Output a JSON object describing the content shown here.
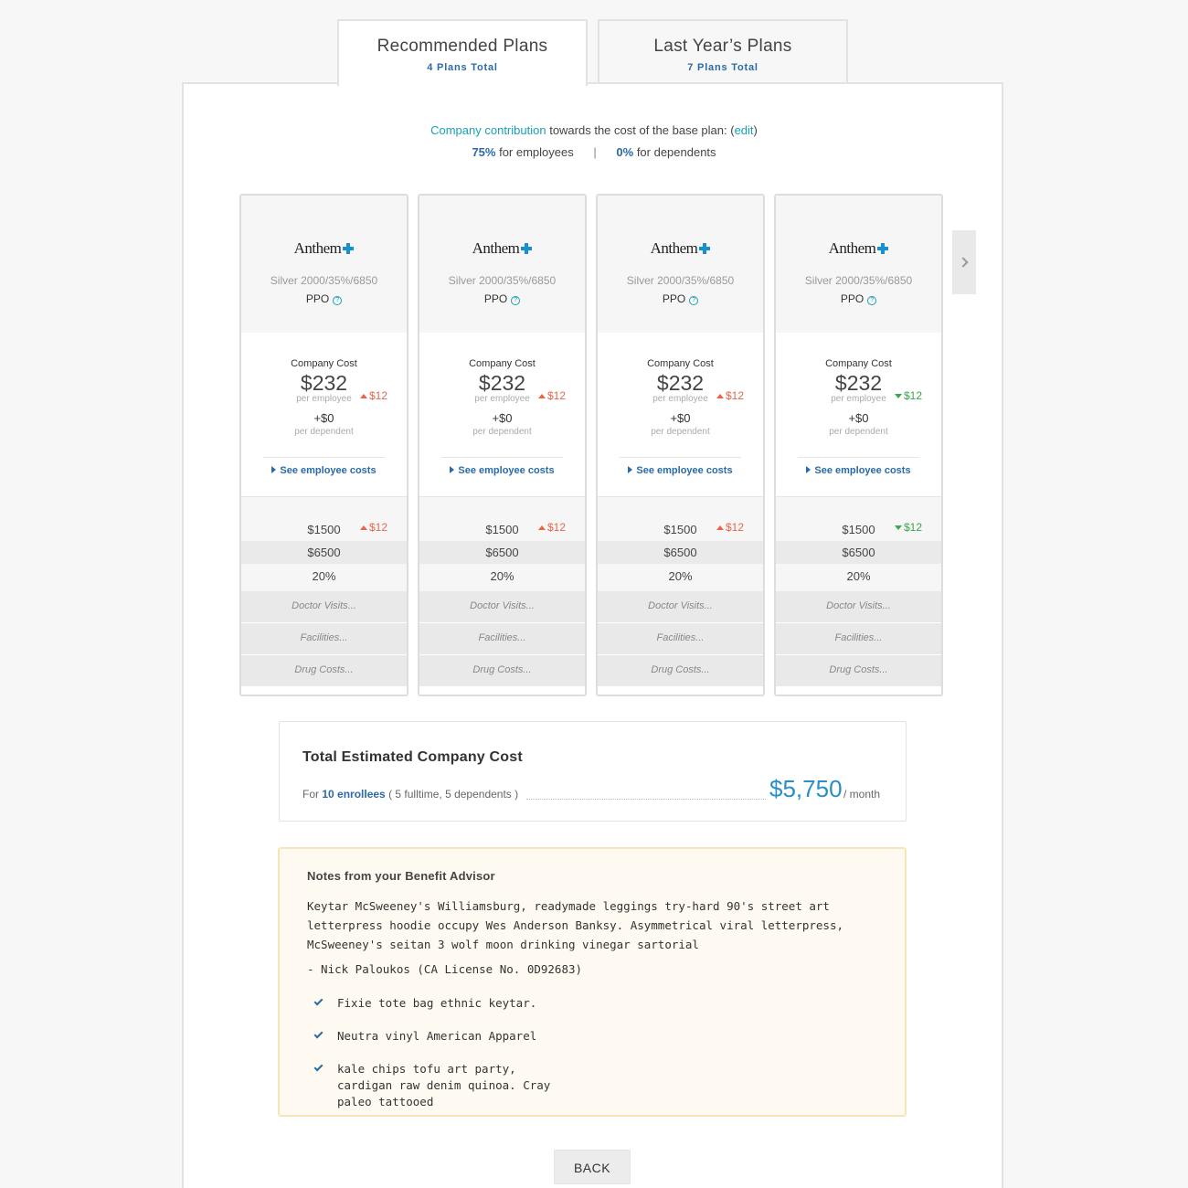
{
  "tabs": [
    {
      "title": "Recommended Plans",
      "subtitle": "4 Plans Total"
    },
    {
      "title": "Last Year’s Plans",
      "subtitle": "7 Plans Total"
    }
  ],
  "contribution": {
    "link_text": "Company contribution",
    "text": "towards the cost of the base plan:",
    "edit_open": "(",
    "edit_label": "edit",
    "edit_close": ")",
    "employee_pct": "75%",
    "employee_text": "for employees",
    "divider": "|",
    "dependent_pct": "0%",
    "dependent_text": "for dependents"
  },
  "cards": [
    {
      "carrier": "Anthem",
      "plan_name": "Silver 2000/35%/6850",
      "plan_type": "PPO",
      "cost_label": "Company Cost",
      "cost": "$232",
      "cost_per": "per employee",
      "cost_delta": "$12",
      "cost_delta_dir": "up",
      "dep_cost": "+$0",
      "dep_per": "per dependent",
      "see_link": "See employee costs",
      "deductible": "$1500",
      "ded_delta": "$12",
      "ded_delta_dir": "up",
      "oop": "$6500",
      "coinsurance": "20%",
      "doctor": "Doctor Visits...",
      "facilities": "Facilities...",
      "drug": "Drug Costs..."
    },
    {
      "carrier": "Anthem",
      "plan_name": "Silver 2000/35%/6850",
      "plan_type": "PPO",
      "cost_label": "Company Cost",
      "cost": "$232",
      "cost_per": "per employee",
      "cost_delta": "$12",
      "cost_delta_dir": "up",
      "dep_cost": "+$0",
      "dep_per": "per dependent",
      "see_link": "See employee costs",
      "deductible": "$1500",
      "ded_delta": "$12",
      "ded_delta_dir": "up",
      "oop": "$6500",
      "coinsurance": "20%",
      "doctor": "Doctor Visits...",
      "facilities": "Facilities...",
      "drug": "Drug Costs..."
    },
    {
      "carrier": "Anthem",
      "plan_name": "Silver 2000/35%/6850",
      "plan_type": "PPO",
      "cost_label": "Company Cost",
      "cost": "$232",
      "cost_per": "per employee",
      "cost_delta": "$12",
      "cost_delta_dir": "up",
      "dep_cost": "+$0",
      "dep_per": "per dependent",
      "see_link": "See employee costs",
      "deductible": "$1500",
      "ded_delta": "$12",
      "ded_delta_dir": "up",
      "oop": "$6500",
      "coinsurance": "20%",
      "doctor": "Doctor Visits...",
      "facilities": "Facilities...",
      "drug": "Drug Costs..."
    },
    {
      "carrier": "Anthem",
      "plan_name": "Silver 2000/35%/6850",
      "plan_type": "PPO",
      "cost_label": "Company Cost",
      "cost": "$232",
      "cost_per": "per employee",
      "cost_delta": "$12",
      "cost_delta_dir": "down",
      "dep_cost": "+$0",
      "dep_per": "per dependent",
      "see_link": "See employee costs",
      "deductible": "$1500",
      "ded_delta": "$12",
      "ded_delta_dir": "down",
      "oop": "$6500",
      "coinsurance": "20%",
      "doctor": "Doctor Visits...",
      "facilities": "Facilities...",
      "drug": "Drug Costs..."
    }
  ],
  "total": {
    "title": "Total Estimated Company Cost",
    "for_prefix": "For",
    "enrollees": "10 enrollees",
    "breakdown": "( 5 fulltime, 5 dependents )",
    "amount": "$5,750",
    "period": "/ month"
  },
  "notes": {
    "title": "Notes from your Benefit Advisor",
    "body": "Keytar McSweeney's Williamsburg, readymade leggings try-hard 90's street art letterpress hoodie occupy Wes Anderson Banksy. Asymmetrical viral letterpress, McSweeney's seitan 3 wolf moon drinking vinegar sartorial",
    "signature": "- Nick Paloukos (CA License No. 0D92683)",
    "items": [
      "Fixie tote bag ethnic keytar.",
      "Neutra vinyl American Apparel",
      "kale chips tofu art party, cardigan raw denim quinoa. Cray paleo tattooed"
    ]
  },
  "back_label": "BACK",
  "colors": {
    "accent": "#2a6aa6",
    "teal": "#1aa0b6",
    "increase": "#e8654a",
    "decrease": "#3aa84a"
  },
  "icons": {
    "next": "chevron-right-icon",
    "check": "check-icon",
    "help": "question-icon"
  }
}
